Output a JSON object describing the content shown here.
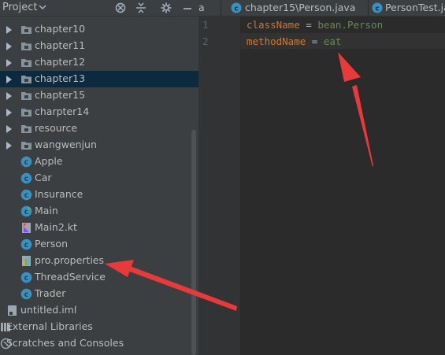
{
  "project": {
    "title": "Project",
    "tree": [
      {
        "type": "folder",
        "label": "chapter10",
        "selected": false
      },
      {
        "type": "folder",
        "label": "chapter11",
        "selected": false
      },
      {
        "type": "folder",
        "label": "chapter12",
        "selected": false
      },
      {
        "type": "folder",
        "label": "chapter13",
        "selected": true
      },
      {
        "type": "folder",
        "label": "chapter15",
        "selected": false
      },
      {
        "type": "folder",
        "label": "charpter14",
        "selected": false
      },
      {
        "type": "folder",
        "label": "resource",
        "selected": false
      },
      {
        "type": "folder",
        "label": "wangwenjun",
        "selected": false
      },
      {
        "type": "class",
        "label": "Apple"
      },
      {
        "type": "class",
        "label": "Car"
      },
      {
        "type": "class",
        "label": "Insurance"
      },
      {
        "type": "main",
        "label": "Main"
      },
      {
        "type": "kotlin",
        "label": "Main2.kt"
      },
      {
        "type": "class",
        "label": "Person"
      },
      {
        "type": "properties",
        "label": "pro.properties"
      },
      {
        "type": "class",
        "label": "ThreadService"
      },
      {
        "type": "class",
        "label": "Trader"
      },
      {
        "type": "iml",
        "label": "untitled.iml"
      },
      {
        "type": "libraries",
        "label": "External Libraries"
      },
      {
        "type": "scratches",
        "label": "Scratches and Consoles"
      }
    ]
  },
  "tabs": [
    {
      "label": "a",
      "active": false
    },
    {
      "label": "chapter15\\Person.java",
      "active": false
    },
    {
      "label": "PersonTest.ja",
      "active": false
    }
  ],
  "editor": {
    "lines": [
      {
        "number": "1",
        "key": "className",
        "sep": " = ",
        "value": "bean.Person"
      },
      {
        "number": "2",
        "key": "methodName",
        "sep": " = ",
        "value": "eat"
      }
    ]
  },
  "colors": {
    "panel": "#3c3f41",
    "editor_bg": "#2b2b2b",
    "selection": "#0d293e",
    "key": "#cc7832",
    "value": "#6a8759",
    "arrow": "#e83a3a"
  }
}
